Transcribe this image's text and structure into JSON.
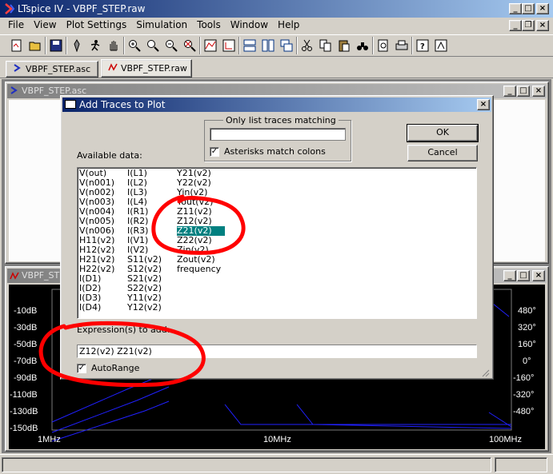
{
  "app": {
    "title": "LTspice IV - VBPF_STEP.raw",
    "menu": [
      "File",
      "View",
      "Plot Settings",
      "Simulation",
      "Tools",
      "Window",
      "Help"
    ],
    "tabs": [
      {
        "label": "VBPF_STEP.asc",
        "icon": "schematic-icon"
      },
      {
        "label": "VBPF_STEP.raw",
        "icon": "waveform-icon"
      }
    ]
  },
  "schematic_window": {
    "title": "VBPF_STEP.asc"
  },
  "plot_window": {
    "title": "VBPF_STEP.raw",
    "left_ticks": [
      "-10dB",
      "-30dB",
      "-50dB",
      "-70dB",
      "-90dB",
      "-110dB",
      "-130dB",
      "-150dB"
    ],
    "right_ticks": [
      "480°",
      "320°",
      "160°",
      "0°",
      "-160°",
      "-320°",
      "-480°",
      ""
    ],
    "x_ticks": [
      "1MHz",
      "10MHz",
      "100MHz"
    ]
  },
  "dialog": {
    "title": "Add Traces to Plot",
    "filter_group_label": "Only list traces matching",
    "filter_value": "",
    "asterisks_label": "Asterisks match colons",
    "asterisks_checked": true,
    "ok_label": "OK",
    "cancel_label": "Cancel",
    "available_label": "Available data:",
    "available_columns": [
      [
        "V(out)",
        "V(n001)",
        "V(n002)",
        "V(n003)",
        "V(n004)",
        "V(n005)",
        "V(n006)",
        "H11(v2)",
        "H12(v2)",
        "H21(v2)",
        "H22(v2)",
        "I(D1)",
        "I(D2)",
        "I(D3)",
        "I(D4)"
      ],
      [
        "I(L1)",
        "I(L2)",
        "I(L3)",
        "I(L4)",
        "I(R1)",
        "I(R2)",
        "I(R3)",
        "I(V1)",
        "I(V2)",
        "S11(v2)",
        "S12(v2)",
        "S21(v2)",
        "S22(v2)",
        "Y11(v2)",
        "Y12(v2)"
      ],
      [
        "Y21(v2)",
        "Y22(v2)",
        "Yin(v2)",
        "Yout(v2)",
        "Z11(v2)",
        "Z12(v2)",
        "Z21(v2)",
        "Z22(v2)",
        "Zin(v2)",
        "Zout(v2)",
        "frequency"
      ]
    ],
    "selected_item": "Z21(v2)",
    "expression_label": "Expression(s) to add:",
    "expression_value": "Z12(v2) Z21(v2)",
    "autorange_label": "AutoRange",
    "autorange_checked": true
  },
  "colors": {
    "selection": "#008080",
    "annotation": "#ff0000",
    "trace_color": "#2020ff",
    "grid_color": "#3a3a3a"
  }
}
